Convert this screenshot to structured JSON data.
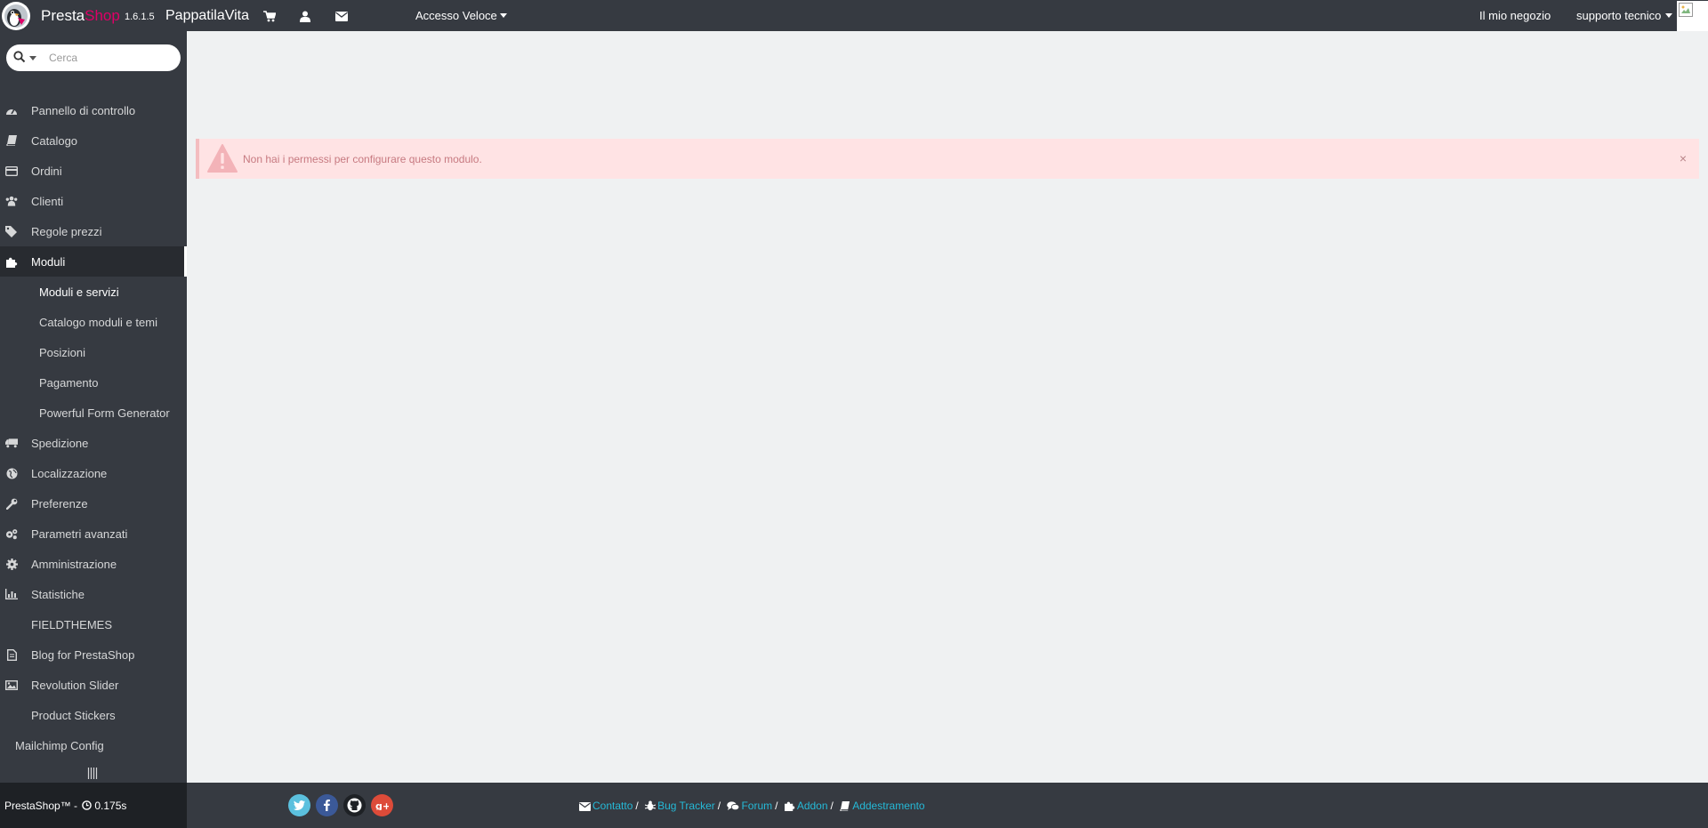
{
  "header": {
    "brand_part1": "Presta",
    "brand_part2": "Shop",
    "version": "1.6.1.5",
    "store_name": "PappatilaVita",
    "quick_access": "Accesso Veloce",
    "my_shop": "Il mio negozio",
    "user": "supporto tecnico"
  },
  "sidebar": {
    "search_placeholder": "Cerca",
    "items": [
      {
        "label": "Pannello di controllo",
        "icon": "dashboard-icon"
      },
      {
        "label": "Catalogo",
        "icon": "book-icon"
      },
      {
        "label": "Ordini",
        "icon": "credit-card-icon"
      },
      {
        "label": "Clienti",
        "icon": "users-icon"
      },
      {
        "label": "Regole prezzi",
        "icon": "tags-icon"
      },
      {
        "label": "Moduli",
        "icon": "puzzle-icon"
      },
      {
        "label": "Spedizione",
        "icon": "truck-icon"
      },
      {
        "label": "Localizzazione",
        "icon": "globe-icon"
      },
      {
        "label": "Preferenze",
        "icon": "wrench-icon"
      },
      {
        "label": "Parametri avanzati",
        "icon": "cogs-icon"
      },
      {
        "label": "Amministrazione",
        "icon": "cog-icon"
      },
      {
        "label": "Statistiche",
        "icon": "bar-chart-icon"
      },
      {
        "label": "FIELDTHEMES",
        "icon": ""
      },
      {
        "label": "Blog for PrestaShop",
        "icon": "file-icon"
      },
      {
        "label": "Revolution Slider",
        "icon": "image-icon"
      },
      {
        "label": "Product Stickers",
        "icon": ""
      },
      {
        "label": "Mailchimp Config",
        "icon": ""
      }
    ],
    "submenu": [
      {
        "label": "Moduli e servizi"
      },
      {
        "label": "Catalogo moduli e temi"
      },
      {
        "label": "Posizioni"
      },
      {
        "label": "Pagamento"
      },
      {
        "label": "Powerful Form Generator"
      }
    ]
  },
  "alert": {
    "message": "Non hai i permessi per configurare questo modulo.",
    "close": "×"
  },
  "footer": {
    "brand": "PrestaShop™ - ",
    "load_time": "0.175s",
    "links": {
      "contact": "Contatto",
      "bug_tracker": "Bug Tracker",
      "forum": "Forum",
      "addon": "Addon",
      "training": "Addestramento"
    },
    "social": {
      "twitter": "twitter-icon",
      "facebook": "facebook-icon",
      "github": "github-icon",
      "google": "google-plus-icon"
    }
  },
  "colors": {
    "header_bg": "#363a41",
    "brand_accent": "#df0067",
    "content_bg": "#eff1f2",
    "alert_bg": "#ffe3e4",
    "alert_text": "#c77a81",
    "link": "#25b9d7",
    "twitter": "#5bc0de",
    "facebook": "#3b5998",
    "github": "#1e2125",
    "google": "#dd4b39"
  }
}
